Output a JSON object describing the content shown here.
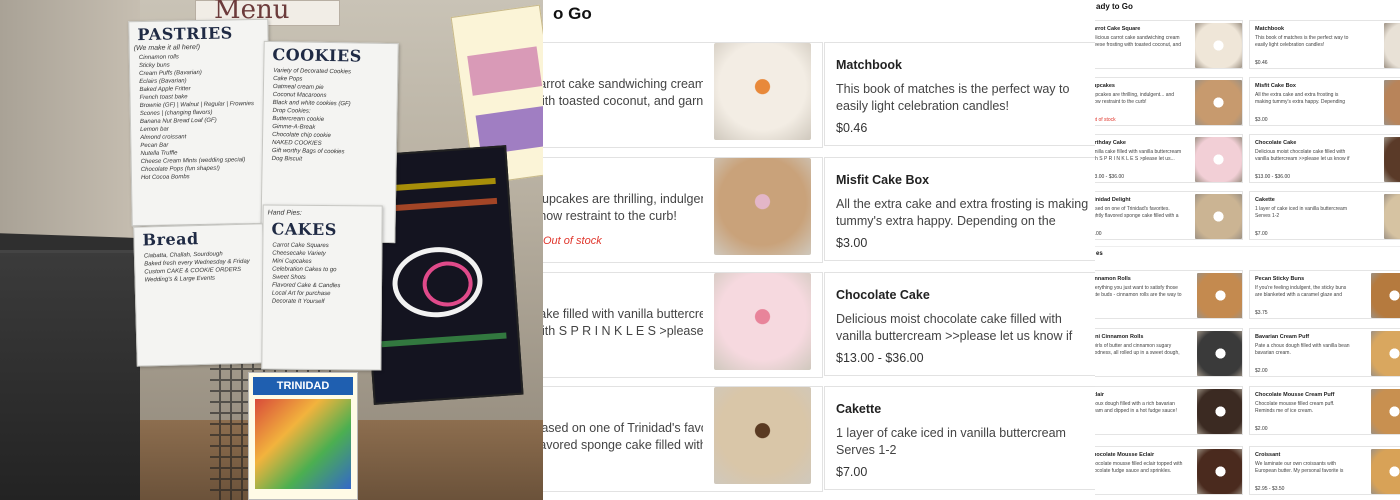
{
  "photo": {
    "menu_sign": "Menu",
    "pastries": {
      "heading": "PASTRIES",
      "note": "(We make it all here!)",
      "items": [
        "Cinnamon rolls",
        "Sticky buns",
        "Cream Puffs (Bavarian)",
        "Eclairs (Bavarian)",
        "Baked Apple Fritter",
        "French toast bake",
        "Brownie (GF) | Walnut | Regular | Frownies",
        "Scones | (changing flavors)",
        "Banana Nut Bread Loaf (GF)",
        "Lemon bar",
        "Almond croissant",
        "Pecan Bar",
        "Nutella Truffle",
        "Cheese Cream Mints (wedding special)",
        "Chocolate Pops (fun shapes!)",
        "Hot Cocoa Bombs"
      ]
    },
    "cookies": {
      "heading": "COOKIES",
      "items": [
        "Variety of Decorated Cookies",
        "Cake Pops",
        "Oatmeal cream pie",
        "Coconut Macaroons",
        "Black and white cookies (GF)",
        "Drop Cookies:",
        "Buttercream cookie",
        "Gimme-A-Break",
        "Chocolate chip cookie",
        "NAKED COOKIES",
        "Gift worthy Bags of cookies",
        "Dog Biscuit"
      ]
    },
    "bread": {
      "heading": "Bread",
      "items": [
        "Ciabatta, Challah, Sourdough",
        "Baked fresh every Wednesday & Friday",
        "Custom CAKE & COOKIE ORDERS",
        "Wedding's & Large Events"
      ]
    },
    "cakes": {
      "heading": "CAKES",
      "pre": "Hand Pies:",
      "items": [
        "Carrot Cake Squares",
        "Cheesecake Variety",
        "Mini Cupcakes",
        "Celebration Cakes to go",
        "Sweet Shots",
        "Flavored Cake & Candles",
        "Local Art for purchase",
        "Decorate It Yourself"
      ]
    },
    "trinidad_flyer": "TRINIDAD"
  },
  "middle": {
    "heading": "Ready to Go",
    "left_column": [
      {
        "lines": [
          "carrot cake sandwiching cream cheese",
          "with toasted coconut, and garnishe..."
        ],
        "aux": "",
        "thumb_color": "#f3ede4",
        "accent": "#e8893a"
      },
      {
        "lines": [
          "Cupcakes are thrilling, indulgent... and",
          "show restraint to the curb!"
        ],
        "aux": "Out of stock",
        "thumb_color": "#c9a27a",
        "accent": "#e3b6c8"
      },
      {
        "lines": [
          "cake filled with vanilla buttercream",
          "with S P R I N K L E S >please let us..."
        ],
        "aux": "",
        "thumb_color": "#f6d9df",
        "accent": "#e8849a"
      },
      {
        "lines": [
          "Based on one of Trinidad's favorites. Lightly",
          "flavored sponge cake filled with a cream..."
        ],
        "aux": "",
        "thumb_color": "#d9c6a8",
        "accent": "#5a3a22"
      }
    ],
    "right_column": [
      {
        "title": "Matchbook",
        "desc": "This book of matches is the perfect way to easily light celebration candles!",
        "price": "$0.46"
      },
      {
        "title": "Misfit Cake Box",
        "desc": "All the extra cake and extra frosting is making tummy's extra happy. Depending on the cake...",
        "price": "$3.00"
      },
      {
        "title": "Chocolate Cake",
        "desc": "Delicious moist chocolate cake filled with vanilla buttercream >>please let us know if you want a...",
        "price": "$13.00 - $36.00"
      },
      {
        "title": "Cakette",
        "desc": "1 layer of cake iced in vanilla buttercream Serves 1-2",
        "price": "$7.00"
      }
    ]
  },
  "right_panel": {
    "heading": "Ready to Go",
    "ready_left": [
      {
        "title": "Carrot Cake Square",
        "desc": "Delicious carrot cake sandwiching cream cheese frosting with toasted coconut, and garnishe...",
        "price": "",
        "aux": "",
        "thumb": "#efe6d8"
      },
      {
        "title": "Cupcakes",
        "desc": "Cupcakes are thrilling, indulgent... and show restraint to the curb!",
        "price": "",
        "aux": "Out of stock",
        "thumb": "#c79a6e"
      },
      {
        "title": "Birthday Cake",
        "desc": "Vanilla cake filled with vanilla buttercream with S P R I N K L E S >please let us...",
        "price": "$13.00 - $36.00",
        "aux": "",
        "thumb": "#f2cfd6"
      },
      {
        "title": "Trinidad Delight",
        "desc": "Based on one of Trinidad's favorites. Lightly flavored sponge cake filled with a cream...",
        "price": "$7.00",
        "aux": "",
        "thumb": "#cbb493"
      }
    ],
    "ready_right": [
      {
        "title": "Matchbook",
        "desc": "This book of matches is the perfect way to easily light celebration candles!",
        "price": "$0.46",
        "thumb": "#e8e1d6"
      },
      {
        "title": "Misfit Cake Box",
        "desc": "All the extra cake and extra frosting is making tummy's extra happy. Depending on the cake...",
        "price": "$3.00",
        "thumb": "#b8845a"
      },
      {
        "title": "Chocolate Cake",
        "desc": "Delicious moist chocolate cake filled with vanilla buttercream >>please let us know if you want a...",
        "price": "$13.00 - $36.00",
        "thumb": "#5a3a28"
      },
      {
        "title": "Cakette",
        "desc": "1 layer of cake iced in vanilla buttercream Serves 1-2",
        "price": "$7.00",
        "thumb": "#d6c3a2"
      }
    ],
    "pastries_heading": "Pastries",
    "pastries_left": [
      {
        "title": "Cinnamon Rolls",
        "desc": "Everything you just want to satisfy those taste buds - cinnamon rolls are the way to go. Sold individually.",
        "price": "",
        "thumb": "#c48a4f"
      },
      {
        "title": "Mini Cinnamon Rolls",
        "desc": "Swirls of butter and cinnamon sugary goodness, all rolled up in a sweet dough, and dripping in...",
        "price": "",
        "thumb": "#3a3a3a"
      },
      {
        "title": "Eclair",
        "desc": "Choux dough filled with a rich bavarian cream and dipped in a hot fudge sauce! Heavenly. *require...",
        "price": "",
        "thumb": "#3b2a22"
      },
      {
        "title": "Chocolate Mousse Eclair",
        "desc": "Chocolate mousse filled eclair topped with chocolate fudge sauce and sprinkles.",
        "price": "",
        "thumb": "#4a2a1e"
      }
    ],
    "pastries_right": [
      {
        "title": "Pecan Sticky Buns",
        "desc": "If you're feeling indulgent, the sticky buns are blanketed with a caramel glaze and sprinkled wi...",
        "price": "$3.75",
        "thumb": "#b57a3e"
      },
      {
        "title": "Bavarian Cream Puff",
        "desc": "Pate a choux dough filled with vanilla bean bavarian cream.",
        "price": "$2.00",
        "thumb": "#d9a75f"
      },
      {
        "title": "Chocolate Mousse Cream Puff",
        "desc": "Chocolate mousse filled cream puff. Reminds me of ice cream.",
        "price": "$2.00",
        "thumb": "#c89050"
      },
      {
        "title": "Croissant",
        "desc": "We laminate our own croissants with European butter. My personal favorite is our chocolate...",
        "price": "$2.95 - $3.50",
        "thumb": "#d8a257"
      }
    ]
  }
}
